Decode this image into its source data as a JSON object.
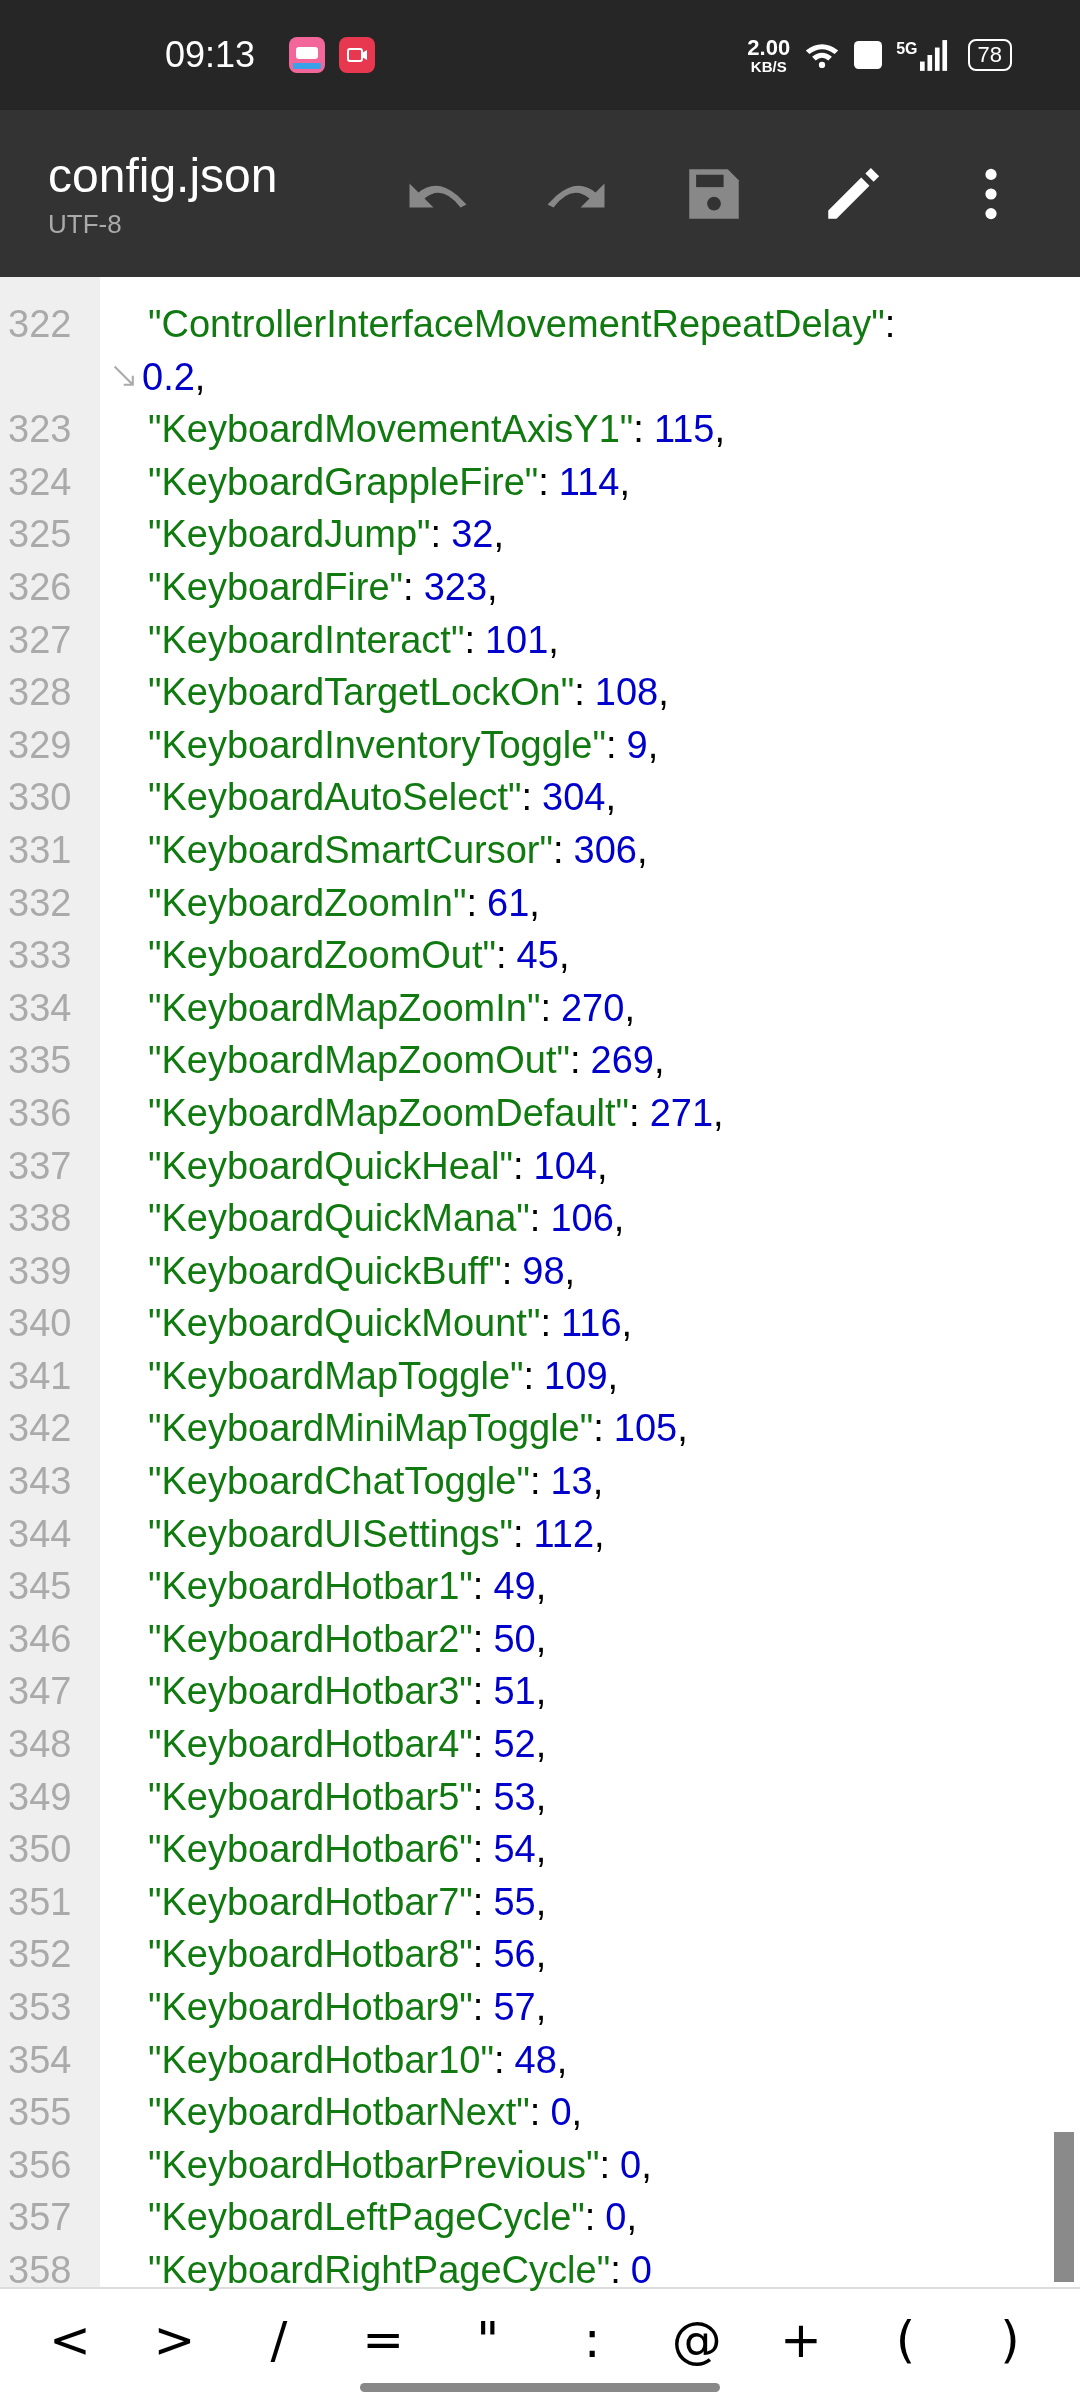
{
  "status_bar": {
    "time": "09:13",
    "speed_value": "2.00",
    "speed_unit": "KB/S",
    "network": "5G",
    "battery": "78"
  },
  "toolbar": {
    "title": "config.json",
    "encoding": "UTF-8",
    "actions": [
      {
        "kind": "undo",
        "disabled": true
      },
      {
        "kind": "redo",
        "disabled": true
      },
      {
        "kind": "save",
        "disabled": true
      },
      {
        "kind": "edit",
        "disabled": false
      },
      {
        "kind": "more",
        "disabled": false
      }
    ]
  },
  "editor": {
    "lines": [
      {
        "number": "322",
        "key": "\"ControllerInterfaceMovementRepeatDelay\"",
        "colon": ":",
        "value": "0.2",
        "tail": ",",
        "wrapped": true
      },
      {
        "number": "323",
        "key": "\"KeyboardMovementAxisY1\"",
        "colon": ":",
        "value": "115",
        "tail": ",",
        "wrapped": false
      },
      {
        "number": "324",
        "key": "\"KeyboardGrappleFire\"",
        "colon": ":",
        "value": "114",
        "tail": ",",
        "wrapped": false
      },
      {
        "number": "325",
        "key": "\"KeyboardJump\"",
        "colon": ":",
        "value": "32",
        "tail": ",",
        "wrapped": false
      },
      {
        "number": "326",
        "key": "\"KeyboardFire\"",
        "colon": ":",
        "value": "323",
        "tail": ",",
        "wrapped": false
      },
      {
        "number": "327",
        "key": "\"KeyboardInteract\"",
        "colon": ":",
        "value": "101",
        "tail": ",",
        "wrapped": false
      },
      {
        "number": "328",
        "key": "\"KeyboardTargetLockOn\"",
        "colon": ":",
        "value": "108",
        "tail": ",",
        "wrapped": false
      },
      {
        "number": "329",
        "key": "\"KeyboardInventoryToggle\"",
        "colon": ":",
        "value": "9",
        "tail": ",",
        "wrapped": false
      },
      {
        "number": "330",
        "key": "\"KeyboardAutoSelect\"",
        "colon": ":",
        "value": "304",
        "tail": ",",
        "wrapped": false
      },
      {
        "number": "331",
        "key": "\"KeyboardSmartCursor\"",
        "colon": ":",
        "value": "306",
        "tail": ",",
        "wrapped": false
      },
      {
        "number": "332",
        "key": "\"KeyboardZoomIn\"",
        "colon": ":",
        "value": "61",
        "tail": ",",
        "wrapped": false
      },
      {
        "number": "333",
        "key": "\"KeyboardZoomOut\"",
        "colon": ":",
        "value": "45",
        "tail": ",",
        "wrapped": false
      },
      {
        "number": "334",
        "key": "\"KeyboardMapZoomIn\"",
        "colon": ":",
        "value": "270",
        "tail": ",",
        "wrapped": false
      },
      {
        "number": "335",
        "key": "\"KeyboardMapZoomOut\"",
        "colon": ":",
        "value": "269",
        "tail": ",",
        "wrapped": false
      },
      {
        "number": "336",
        "key": "\"KeyboardMapZoomDefault\"",
        "colon": ":",
        "value": "271",
        "tail": ",",
        "wrapped": false
      },
      {
        "number": "337",
        "key": "\"KeyboardQuickHeal\"",
        "colon": ":",
        "value": "104",
        "tail": ",",
        "wrapped": false
      },
      {
        "number": "338",
        "key": "\"KeyboardQuickMana\"",
        "colon": ":",
        "value": "106",
        "tail": ",",
        "wrapped": false
      },
      {
        "number": "339",
        "key": "\"KeyboardQuickBuff\"",
        "colon": ":",
        "value": "98",
        "tail": ",",
        "wrapped": false
      },
      {
        "number": "340",
        "key": "\"KeyboardQuickMount\"",
        "colon": ":",
        "value": "116",
        "tail": ",",
        "wrapped": false
      },
      {
        "number": "341",
        "key": "\"KeyboardMapToggle\"",
        "colon": ":",
        "value": "109",
        "tail": ",",
        "wrapped": false
      },
      {
        "number": "342",
        "key": "\"KeyboardMiniMapToggle\"",
        "colon": ":",
        "value": "105",
        "tail": ",",
        "wrapped": false
      },
      {
        "number": "343",
        "key": "\"KeyboardChatToggle\"",
        "colon": ":",
        "value": "13",
        "tail": ",",
        "wrapped": false
      },
      {
        "number": "344",
        "key": "\"KeyboardUISettings\"",
        "colon": ":",
        "value": "112",
        "tail": ",",
        "wrapped": false
      },
      {
        "number": "345",
        "key": "\"KeyboardHotbar1\"",
        "colon": ":",
        "value": "49",
        "tail": ",",
        "wrapped": false
      },
      {
        "number": "346",
        "key": "\"KeyboardHotbar2\"",
        "colon": ":",
        "value": "50",
        "tail": ",",
        "wrapped": false
      },
      {
        "number": "347",
        "key": "\"KeyboardHotbar3\"",
        "colon": ":",
        "value": "51",
        "tail": ",",
        "wrapped": false
      },
      {
        "number": "348",
        "key": "\"KeyboardHotbar4\"",
        "colon": ":",
        "value": "52",
        "tail": ",",
        "wrapped": false
      },
      {
        "number": "349",
        "key": "\"KeyboardHotbar5\"",
        "colon": ":",
        "value": "53",
        "tail": ",",
        "wrapped": false
      },
      {
        "number": "350",
        "key": "\"KeyboardHotbar6\"",
        "colon": ":",
        "value": "54",
        "tail": ",",
        "wrapped": false
      },
      {
        "number": "351",
        "key": "\"KeyboardHotbar7\"",
        "colon": ":",
        "value": "55",
        "tail": ",",
        "wrapped": false
      },
      {
        "number": "352",
        "key": "\"KeyboardHotbar8\"",
        "colon": ":",
        "value": "56",
        "tail": ",",
        "wrapped": false
      },
      {
        "number": "353",
        "key": "\"KeyboardHotbar9\"",
        "colon": ":",
        "value": "57",
        "tail": ",",
        "wrapped": false
      },
      {
        "number": "354",
        "key": "\"KeyboardHotbar10\"",
        "colon": ":",
        "value": "48",
        "tail": ",",
        "wrapped": false
      },
      {
        "number": "355",
        "key": "\"KeyboardHotbarNext\"",
        "colon": ":",
        "value": "0",
        "tail": ",",
        "wrapped": false
      },
      {
        "number": "356",
        "key": "\"KeyboardHotbarPrevious\"",
        "colon": ":",
        "value": "0",
        "tail": ",",
        "wrapped": false
      },
      {
        "number": "357",
        "key": "\"KeyboardLeftPageCycle\"",
        "colon": ":",
        "value": "0",
        "tail": ",",
        "wrapped": false
      },
      {
        "number": "358",
        "key": "\"KeyboardRightPageCycle\"",
        "colon": ":",
        "value": "0",
        "wrapped": false
      }
    ]
  },
  "symbol_bar": [
    "<",
    ">",
    "/",
    "=",
    "\"",
    ":",
    "@",
    "+",
    "(",
    ")"
  ]
}
